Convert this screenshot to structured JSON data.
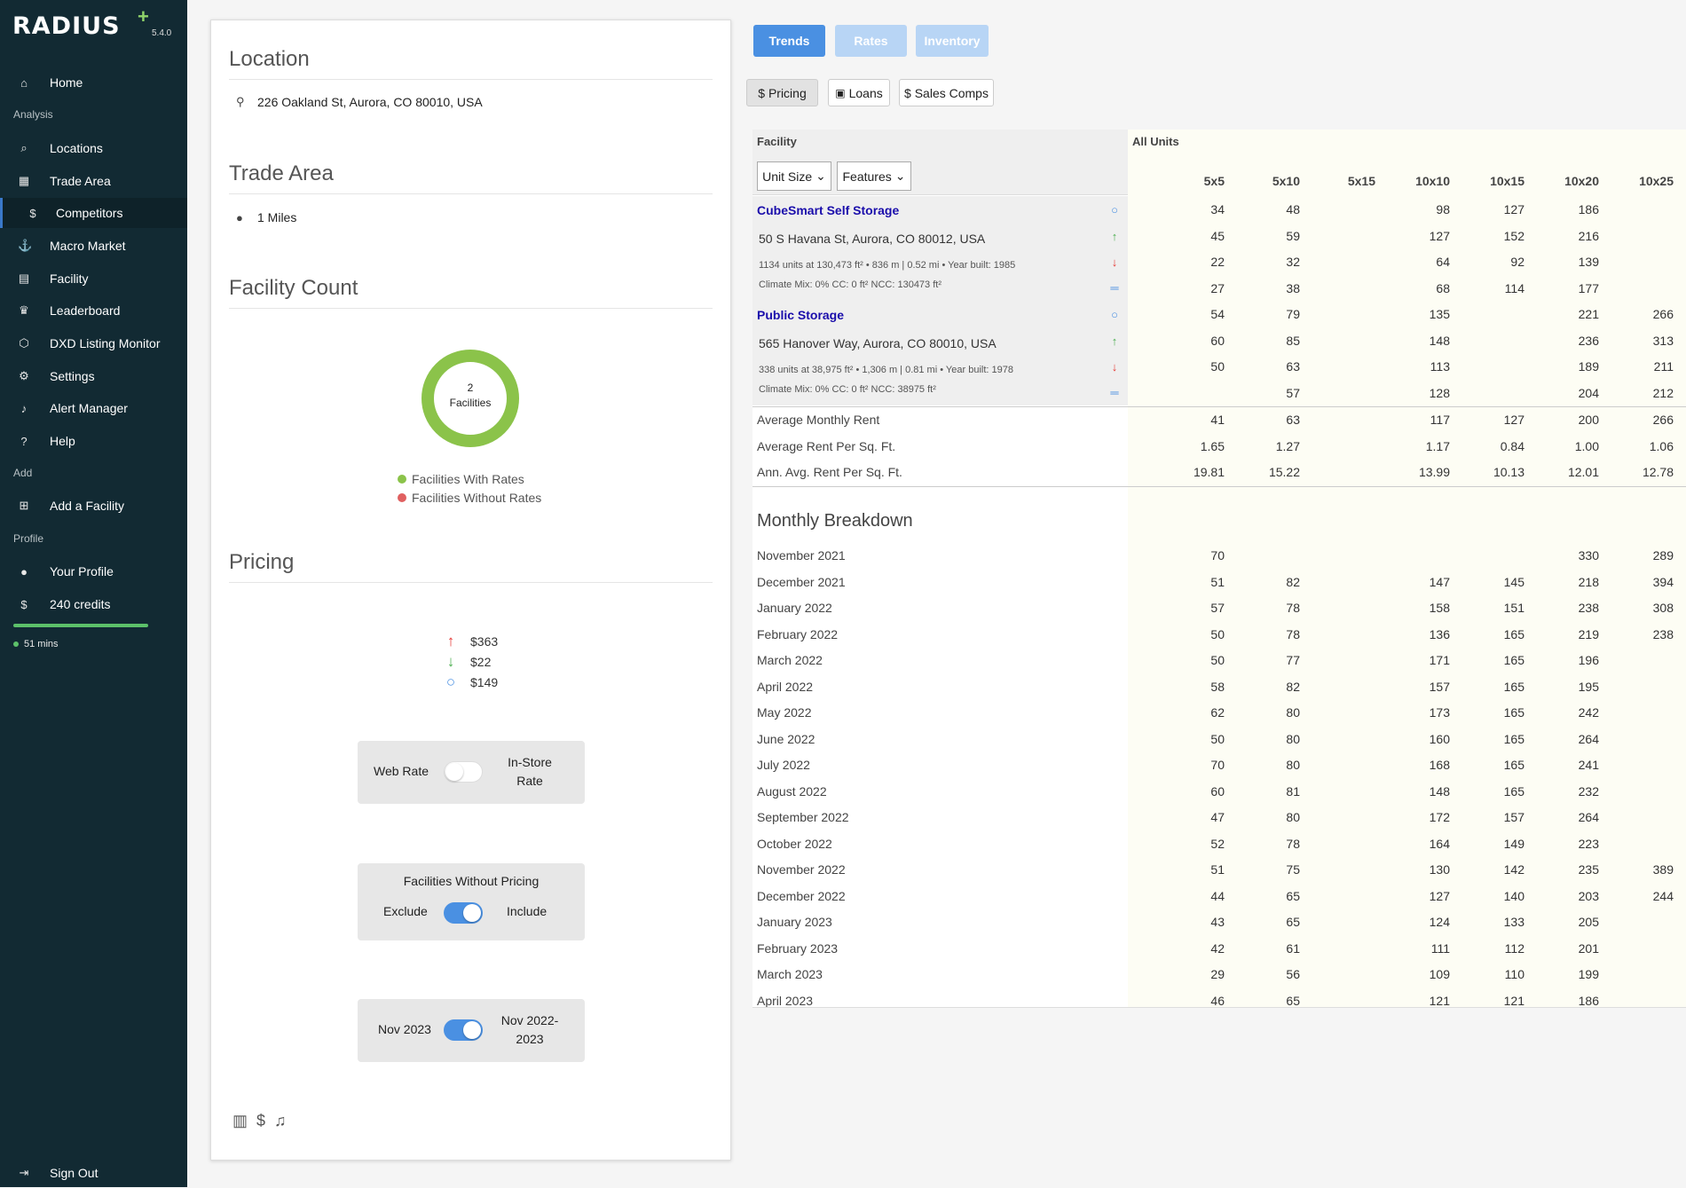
{
  "app": {
    "logo": "RADIUS",
    "logo_plus": "+",
    "version": "5.4.0"
  },
  "sidebar": {
    "items": [
      {
        "label": "Home",
        "icon": "⌂"
      },
      {
        "label": "Locations",
        "icon": "⌕"
      },
      {
        "label": "Trade Area",
        "icon": "▦"
      },
      {
        "label": "Competitors",
        "icon": "$"
      },
      {
        "label": "Macro Market",
        "icon": "⚓"
      },
      {
        "label": "Facility",
        "icon": "▤"
      },
      {
        "label": "Leaderboard",
        "icon": "♛"
      },
      {
        "label": "DXD Listing Monitor",
        "icon": "⬡"
      },
      {
        "label": "Settings",
        "icon": "⚙"
      },
      {
        "label": "Alert Manager",
        "icon": "♪"
      },
      {
        "label": "Help",
        "icon": "?"
      },
      {
        "label": "Add a Facility",
        "icon": "⊞"
      },
      {
        "label": "Your Profile",
        "icon": "●"
      },
      {
        "label": "240 credits",
        "icon": "$"
      },
      {
        "label": "Sign Out",
        "icon": "⇥"
      }
    ],
    "sections": [
      "Analysis",
      "Add",
      "Profile"
    ],
    "session": "51 mins"
  },
  "panel": {
    "location_title": "Location",
    "location_address": "226 Oakland St, Aurora, CO 80010, USA",
    "trade_title": "Trade Area",
    "trade_value": "1 Miles",
    "count_title": "Facility Count",
    "donut_count": "2",
    "donut_label": "Facilities",
    "legend_with": "Facilities With Rates",
    "legend_without": "Facilities Without Rates",
    "pricing_title": "Pricing",
    "price_high": "$363",
    "price_low": "$22",
    "price_avg": "$149",
    "toggle1_left": "Web Rate",
    "toggle1_right": "In-Store Rate",
    "toggle2_title": "Facilities Without Pricing",
    "toggle2_left": "Exclude",
    "toggle2_right": "Include",
    "toggle3_left": "Nov 2023",
    "toggle3_right": "Nov 2022-2023"
  },
  "tabs": {
    "trends": "Trends",
    "rates": "Rates",
    "inventory": "Inventory"
  },
  "subtabs": {
    "pricing": "$ Pricing",
    "loans": "Loans",
    "sales": "$ Sales Comps"
  },
  "table": {
    "facility_label": "Facility",
    "all_units_label": "All Units",
    "unit_size_filter": "Unit Size",
    "features_filter": "Features",
    "columns": [
      "5x5",
      "5x10",
      "5x15",
      "10x10",
      "10x15",
      "10x20",
      "10x25"
    ],
    "facilities": [
      {
        "name": "CubeSmart Self Storage",
        "address": "50 S Havana St, Aurora, CO 80012, USA",
        "meta1": "1134 units at 130,473 ft² • 836 m | 0.52 mi • Year built: 1985",
        "meta2": "Climate Mix: 0% CC: 0 ft² NCC: 130473 ft²",
        "rows": [
          [
            "34",
            "48",
            "",
            "98",
            "127",
            "186",
            ""
          ],
          [
            "45",
            "59",
            "",
            "127",
            "152",
            "216",
            ""
          ],
          [
            "22",
            "32",
            "",
            "64",
            "92",
            "139",
            ""
          ],
          [
            "27",
            "38",
            "",
            "68",
            "114",
            "177",
            ""
          ]
        ]
      },
      {
        "name": "Public Storage",
        "address": "565 Hanover Way, Aurora, CO 80010, USA",
        "meta1": "338 units at 38,975 ft² • 1,306 m | 0.81 mi • Year built: 1978",
        "meta2": "Climate Mix: 0% CC: 0 ft² NCC: 38975 ft²",
        "rows": [
          [
            "54",
            "79",
            "",
            "135",
            "",
            "221",
            "266"
          ],
          [
            "60",
            "85",
            "",
            "148",
            "",
            "236",
            "313"
          ],
          [
            "50",
            "63",
            "",
            "113",
            "",
            "189",
            "211"
          ],
          [
            "",
            "57",
            "",
            "128",
            "",
            "204",
            "212"
          ]
        ]
      }
    ],
    "summary": [
      {
        "label": "Average Monthly Rent",
        "values": [
          "41",
          "63",
          "",
          "117",
          "127",
          "200",
          "266"
        ]
      },
      {
        "label": "Average Rent Per Sq. Ft.",
        "values": [
          "1.65",
          "1.27",
          "",
          "1.17",
          "0.84",
          "1.00",
          "1.06"
        ]
      },
      {
        "label": "Ann. Avg. Rent Per Sq. Ft.",
        "values": [
          "19.81",
          "15.22",
          "",
          "13.99",
          "10.13",
          "12.01",
          "12.78"
        ]
      }
    ],
    "monthly_title": "Monthly Breakdown",
    "monthly": [
      {
        "label": "November 2021",
        "values": [
          "70",
          "",
          "",
          "",
          "",
          "330",
          "289"
        ]
      },
      {
        "label": "December 2021",
        "values": [
          "51",
          "82",
          "",
          "147",
          "145",
          "218",
          "394"
        ]
      },
      {
        "label": "January 2022",
        "values": [
          "57",
          "78",
          "",
          "158",
          "151",
          "238",
          "308"
        ]
      },
      {
        "label": "February 2022",
        "values": [
          "50",
          "78",
          "",
          "136",
          "165",
          "219",
          "238"
        ]
      },
      {
        "label": "March 2022",
        "values": [
          "50",
          "77",
          "",
          "171",
          "165",
          "196",
          ""
        ]
      },
      {
        "label": "April 2022",
        "values": [
          "58",
          "82",
          "",
          "157",
          "165",
          "195",
          ""
        ]
      },
      {
        "label": "May 2022",
        "values": [
          "62",
          "80",
          "",
          "173",
          "165",
          "242",
          ""
        ]
      },
      {
        "label": "June 2022",
        "values": [
          "50",
          "80",
          "",
          "160",
          "165",
          "264",
          ""
        ]
      },
      {
        "label": "July 2022",
        "values": [
          "70",
          "80",
          "",
          "168",
          "165",
          "241",
          ""
        ]
      },
      {
        "label": "August 2022",
        "values": [
          "60",
          "81",
          "",
          "148",
          "165",
          "232",
          ""
        ]
      },
      {
        "label": "September 2022",
        "values": [
          "47",
          "80",
          "",
          "172",
          "157",
          "264",
          ""
        ]
      },
      {
        "label": "October 2022",
        "values": [
          "52",
          "78",
          "",
          "164",
          "149",
          "223",
          ""
        ]
      },
      {
        "label": "November 2022",
        "values": [
          "51",
          "75",
          "",
          "130",
          "142",
          "235",
          "389"
        ]
      },
      {
        "label": "December 2022",
        "values": [
          "44",
          "65",
          "",
          "127",
          "140",
          "203",
          "244"
        ]
      },
      {
        "label": "January 2023",
        "values": [
          "43",
          "65",
          "",
          "124",
          "133",
          "205",
          ""
        ]
      },
      {
        "label": "February 2023",
        "values": [
          "42",
          "61",
          "",
          "111",
          "112",
          "201",
          ""
        ]
      },
      {
        "label": "March 2023",
        "values": [
          "29",
          "56",
          "",
          "109",
          "110",
          "199",
          ""
        ]
      },
      {
        "label": "April 2023",
        "values": [
          "46",
          "65",
          "",
          "121",
          "121",
          "186",
          ""
        ]
      }
    ]
  },
  "colors": {
    "sidebar_bg": "#122a33",
    "accent": "#4a90e2",
    "up": "#4caf50",
    "down": "#e53935",
    "with_rates": "#8bc34a",
    "without_rates": "#e06060"
  }
}
